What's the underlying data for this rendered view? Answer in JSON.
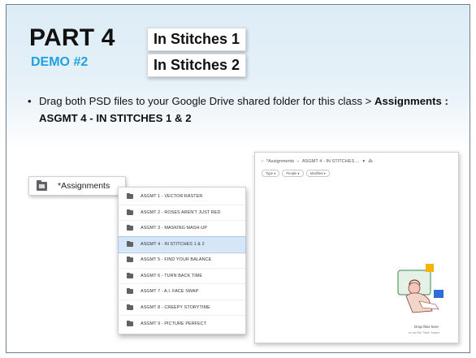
{
  "slide": {
    "title": "PART 4",
    "subtitle": "DEMO #2",
    "chips": [
      "In Stitches 1",
      "In Stitches 2"
    ],
    "bullet": {
      "marker": "•",
      "text": "Drag both PSD files to your Google Drive shared folder for this class > ",
      "bold": "Assignments : ASGMT 4 - IN STITCHES 1 & 2"
    }
  },
  "folder_pill": {
    "label": "*Assignments",
    "icon": "folder-icon"
  },
  "folder_list": {
    "items": [
      {
        "label": "ASGMT 1 - VECTOR:RASTER",
        "selected": false
      },
      {
        "label": "ASGMT 2 - ROSES AREN'T JUST RED",
        "selected": false
      },
      {
        "label": "ASGMT 3 - MASKING MASH-UP",
        "selected": false
      },
      {
        "label": "ASGMT 4 - IN STITCHES 1 & 2",
        "selected": true
      },
      {
        "label": "ASGMT 5 - FIND YOUR BALANCE",
        "selected": false
      },
      {
        "label": "ASGMT 6 - TURN BACK TIME",
        "selected": false
      },
      {
        "label": "ASGMT 7 - A.I. FACE SWAP",
        "selected": false
      },
      {
        "label": "ASGMT 8 - CREEPY STORYTIME",
        "selected": false
      },
      {
        "label": "ASGMT 9 - PICTURE PERFECT",
        "selected": false
      }
    ]
  },
  "drive": {
    "breadcrumb": [
      "›",
      "*Assignments",
      "›",
      "ASGMT 4 - IN STITCHES ...",
      "▾",
      "⁂"
    ],
    "filters": [
      "Type ▾",
      "People ▾",
      "Modified ▾"
    ],
    "drop_title": "Drop files here",
    "drop_subtitle": "or use the \"New\" button"
  },
  "colors": {
    "accent_blue": "#1fa0e0",
    "selected_row": "#d5e6f7",
    "header_band": "#dcecf6"
  }
}
